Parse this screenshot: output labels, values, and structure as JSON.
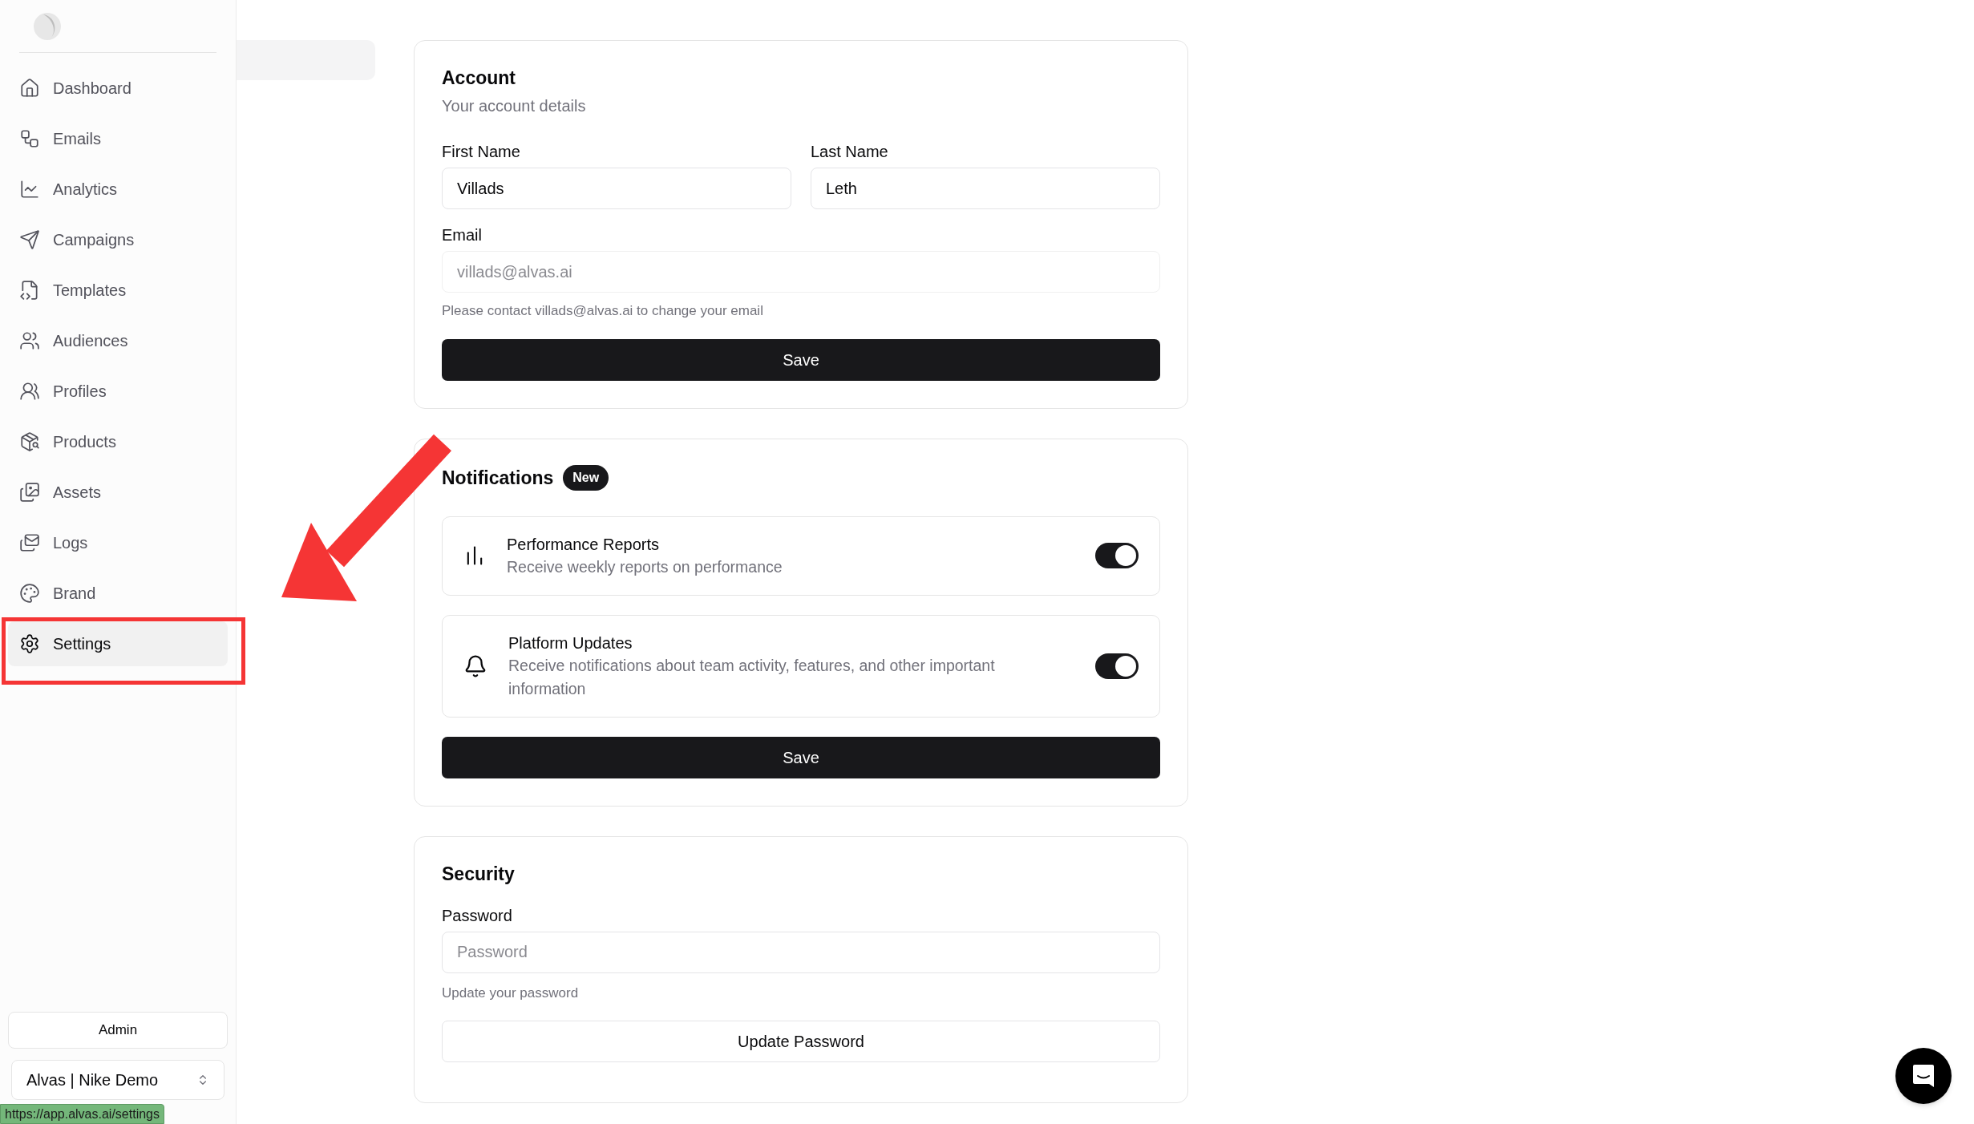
{
  "sidebar": {
    "items": [
      {
        "label": "Dashboard",
        "selected": false
      },
      {
        "label": "Emails",
        "selected": false
      },
      {
        "label": "Analytics",
        "selected": false
      },
      {
        "label": "Campaigns",
        "selected": false
      },
      {
        "label": "Templates",
        "selected": false
      },
      {
        "label": "Audiences",
        "selected": false
      },
      {
        "label": "Profiles",
        "selected": false
      },
      {
        "label": "Products",
        "selected": false
      },
      {
        "label": "Assets",
        "selected": false
      },
      {
        "label": "Logs",
        "selected": false
      },
      {
        "label": "Brand",
        "selected": false
      },
      {
        "label": "Settings",
        "selected": true
      }
    ],
    "role_button": "Admin",
    "workspace": "Alvas | Nike Demo"
  },
  "account": {
    "title": "Account",
    "subtitle": "Your account details",
    "first_name": {
      "label": "First Name",
      "value": "Villads"
    },
    "last_name": {
      "label": "Last Name",
      "value": "Leth"
    },
    "email": {
      "label": "Email",
      "placeholder": "villads@alvas.ai",
      "help": "Please contact villads@alvas.ai to change your email"
    },
    "save": "Save"
  },
  "notifications": {
    "title": "Notifications",
    "badge": "New",
    "items": [
      {
        "title": "Performance Reports",
        "description": "Receive weekly reports on performance",
        "on": true
      },
      {
        "title": "Platform Updates",
        "description": "Receive notifications about team activity, features, and other important information",
        "on": true
      }
    ],
    "save": "Save"
  },
  "security": {
    "title": "Security",
    "password": {
      "label": "Password",
      "placeholder": "Password",
      "help": "Update your password"
    },
    "button": "Update Password"
  },
  "status_url": "https://app.alvas.ai/settings"
}
